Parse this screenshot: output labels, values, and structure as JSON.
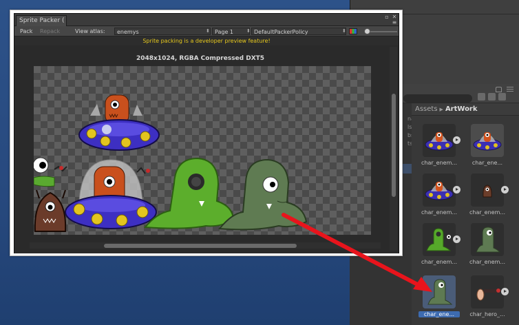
{
  "sprite_packer": {
    "tab_title": "Sprite Packer (",
    "toolbar": {
      "pack_label": "Pack",
      "repack_label": "Repack",
      "view_atlas_label": "View atlas:",
      "atlas_value": "enemys",
      "page_value": "Page 1",
      "policy_value": "DefaultPackerPolicy"
    },
    "notice": "Sprite packing is a developer preview feature!",
    "atlas_info": "2048x1024, RGBA Compressed DXT5"
  },
  "project": {
    "breadcrumb_root": "Assets",
    "breadcrumb_current": "ArtWork",
    "side_fragments": [
      "nal",
      "ls",
      "bs",
      "ts"
    ],
    "assets": [
      {
        "label": "char_enem...",
        "selected": false,
        "has_play": true,
        "icon": "ufo-monster-icon"
      },
      {
        "label": "char_ene...",
        "selected": false,
        "has_play": false,
        "icon": "ufo-monster-icon"
      },
      {
        "label": "char_enem...",
        "selected": false,
        "has_play": true,
        "icon": "ufo-monster-icon"
      },
      {
        "label": "char_enem...",
        "selected": false,
        "has_play": true,
        "icon": "brown-monster-icon"
      },
      {
        "label": "char_enem...",
        "selected": false,
        "has_play": true,
        "icon": "green-slime-icon"
      },
      {
        "label": "char_enem...",
        "selected": false,
        "has_play": false,
        "icon": "dark-slime-icon"
      },
      {
        "label": "char_ene...",
        "selected": true,
        "has_play": false,
        "icon": "dark-slime-icon"
      },
      {
        "label": "char_hero_...",
        "selected": false,
        "has_play": true,
        "icon": "hero-arm-icon"
      }
    ]
  },
  "colors": {
    "notice_yellow": "#e6c81d",
    "arrow_red": "#e8141c",
    "selection_blue": "#3d6bb0"
  }
}
